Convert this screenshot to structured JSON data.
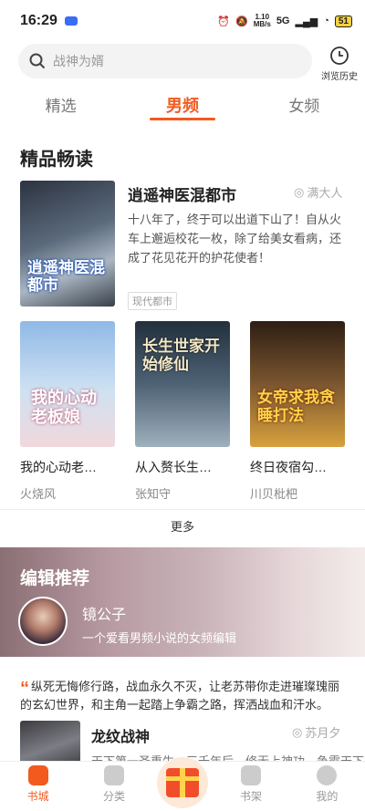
{
  "status": {
    "time": "16:29",
    "speed_value": "1.10",
    "speed_unit": "MB/s",
    "network": "5G",
    "battery": "51"
  },
  "search": {
    "placeholder": "战神为婿"
  },
  "history": {
    "label": "浏览历史"
  },
  "tabs": [
    {
      "label": "精选"
    },
    {
      "label": "男频"
    },
    {
      "label": "女频"
    }
  ],
  "section": {
    "title": "精品畅读"
  },
  "featured": {
    "title": "逍遥神医混都市",
    "author": "满大人",
    "description": "十八年了，终于可以出道下山了！自从火车上邂逅校花一枚，除了给美女看病，还成了花见花开的护花使者！",
    "tag": "现代都市",
    "cover_text": "逍遥神医混都市"
  },
  "grid": [
    {
      "name": "我的心动老…",
      "author": "火烧风",
      "cover_text": "我的心动老板娘"
    },
    {
      "name": "从入赘长生…",
      "author": "张知守",
      "cover_text": "长生世家开始修仙"
    },
    {
      "name": "终日夜宿勾…",
      "author": "川贝枇杷",
      "cover_text": "女帝求我贪睡打法"
    }
  ],
  "more": {
    "label": "更多"
  },
  "editor": {
    "title": "编辑推荐",
    "name": "镜公子",
    "desc": "一个爱看男频小说的女频编辑"
  },
  "quote": "纵死无悔修行路，战血永久不灭，让老苏带你走进璀璨瑰丽的玄幻世界，和主角一起踏上争霸之路，挥洒战血和汗水。",
  "rec": {
    "title": "龙纹战神",
    "author": "苏月夕",
    "desc": "天下第一圣重生，三千年后，修无上神功，争霸天下"
  },
  "nav": [
    {
      "label": "书城"
    },
    {
      "label": "分类"
    },
    {
      "label": "书架"
    },
    {
      "label": "我的"
    }
  ]
}
